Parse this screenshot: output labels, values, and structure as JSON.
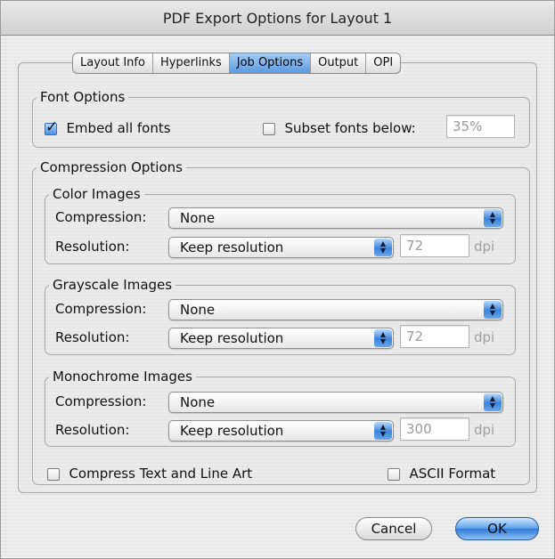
{
  "window": {
    "title": "PDF Export Options for Layout 1"
  },
  "tabs": [
    {
      "label": "Layout Info",
      "active": false
    },
    {
      "label": "Hyperlinks",
      "active": false
    },
    {
      "label": "Job Options",
      "active": true
    },
    {
      "label": "Output",
      "active": false
    },
    {
      "label": "OPI",
      "active": false
    }
  ],
  "font_options": {
    "legend": "Font Options",
    "embed_all_fonts": {
      "label": "Embed all fonts",
      "checked": true
    },
    "subset_fonts": {
      "label": "Subset fonts below:",
      "checked": false,
      "value": "35%"
    }
  },
  "compression_options": {
    "legend": "Compression Options",
    "groups": [
      {
        "legend": "Color Images",
        "compression_label": "Compression:",
        "compression_value": "None",
        "resolution_label": "Resolution:",
        "resolution_value": "Keep resolution",
        "dpi_value": "72",
        "dpi_unit": "dpi"
      },
      {
        "legend": "Grayscale Images",
        "compression_label": "Compression:",
        "compression_value": "None",
        "resolution_label": "Resolution:",
        "resolution_value": "Keep resolution",
        "dpi_value": "72",
        "dpi_unit": "dpi"
      },
      {
        "legend": "Monochrome Images",
        "compression_label": "Compression:",
        "compression_value": "None",
        "resolution_label": "Resolution:",
        "resolution_value": "Keep resolution",
        "dpi_value": "300",
        "dpi_unit": "dpi"
      }
    ],
    "compress_text": {
      "label": "Compress Text and Line Art",
      "checked": false
    },
    "ascii_format": {
      "label": "ASCII Format",
      "checked": false
    }
  },
  "buttons": {
    "cancel": "Cancel",
    "ok": "OK"
  },
  "colors": {
    "accent": "#5c9ae0",
    "window_bg": "#ececec"
  }
}
